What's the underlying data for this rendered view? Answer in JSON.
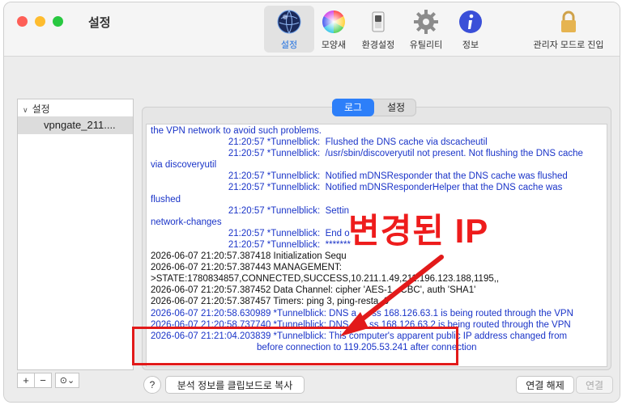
{
  "window": {
    "title": "설정"
  },
  "toolbar": {
    "items": [
      {
        "label": "설정",
        "icon": "globe-icon"
      },
      {
        "label": "모양새",
        "icon": "color-wheel-icon"
      },
      {
        "label": "환경설정",
        "icon": "switch-icon"
      },
      {
        "label": "유틸리티",
        "icon": "gear-icon"
      },
      {
        "label": "정보",
        "icon": "info-icon"
      }
    ],
    "lock_label": "관리자 모드로 진입"
  },
  "sidebar": {
    "group_label": "설정",
    "item_label": "vpngate_211....",
    "controls": {
      "add": "+",
      "remove": "−",
      "more": "⊙⌄"
    }
  },
  "tabs": {
    "log": "로그",
    "settings": "설정",
    "active": "log"
  },
  "log": {
    "lines": [
      {
        "color": "blue",
        "text": "the VPN network to avoid such problems."
      },
      {
        "color": "blue",
        "text": "                              21:20:57 *Tunnelblick:  Flushed the DNS cache via dscacheutil"
      },
      {
        "color": "blue",
        "text": "                              21:20:57 *Tunnelblick:  /usr/sbin/discoveryutil not present. Not flushing the DNS cache"
      },
      {
        "color": "blue",
        "text": "via discoveryutil"
      },
      {
        "color": "blue",
        "text": "                              21:20:57 *Tunnelblick:  Notified mDNSResponder that the DNS cache was flushed"
      },
      {
        "color": "blue",
        "text": "                              21:20:57 *Tunnelblick:  Notified mDNSResponderHelper that the DNS cache was"
      },
      {
        "color": "blue",
        "text": "flushed"
      },
      {
        "color": "blue",
        "text": "                              21:20:57 *Tunnelblick:  Settin"
      },
      {
        "color": "blue",
        "text": "network-changes"
      },
      {
        "color": "blue",
        "text": "                              21:20:57 *Tunnelblick:  End o"
      },
      {
        "color": "blue",
        "text": "                              21:20:57 *Tunnelblick:  *******"
      },
      {
        "color": "black",
        "text": "2026-06-07 21:20:57.387418 Initialization Sequ"
      },
      {
        "color": "black",
        "text": "2026-06-07 21:20:57.387443 MANAGEMENT:"
      },
      {
        "color": "black",
        "text": ">STATE:1780834857,CONNECTED,SUCCESS,10.211.1.49,211.196.123.188,1195,,"
      },
      {
        "color": "black",
        "text": "2026-06-07 21:20:57.387452 Data Channel: cipher 'AES-1  -CBC', auth 'SHA1'"
      },
      {
        "color": "black",
        "text": "2026-06-07 21:20:57.387457 Timers: ping 3, ping-resta  0"
      },
      {
        "color": "blue",
        "text": "2026-06-07 21:20:58.630989 *Tunnelblick: DNS a      ss 168.126.63.1 is being routed through the VPN"
      },
      {
        "color": "blue",
        "text": "2026-06-07 21:20:58.737740 *Tunnelblick: DNS        ss 168.126.63.2 is being routed through the VPN"
      },
      {
        "color": "blue",
        "text": "2026-06-07 21:21:04.203839 *Tunnelblick: This computer's apparent public IP address changed from"
      },
      {
        "color": "blue",
        "text": "                                         before connection to 119.205.53.241 after connection",
        "redacted_prefix": true
      }
    ]
  },
  "annotation": {
    "text": "변경된 IP"
  },
  "bottom": {
    "help": "?",
    "copy_label": "분석 정보를 클립보드로 복사",
    "disconnect_label": "연결 해제",
    "connect_label": "연결"
  },
  "colors": {
    "accent": "#2d7ff9",
    "log_blue": "#1a34c8",
    "annotation_red": "#e21a1a"
  }
}
